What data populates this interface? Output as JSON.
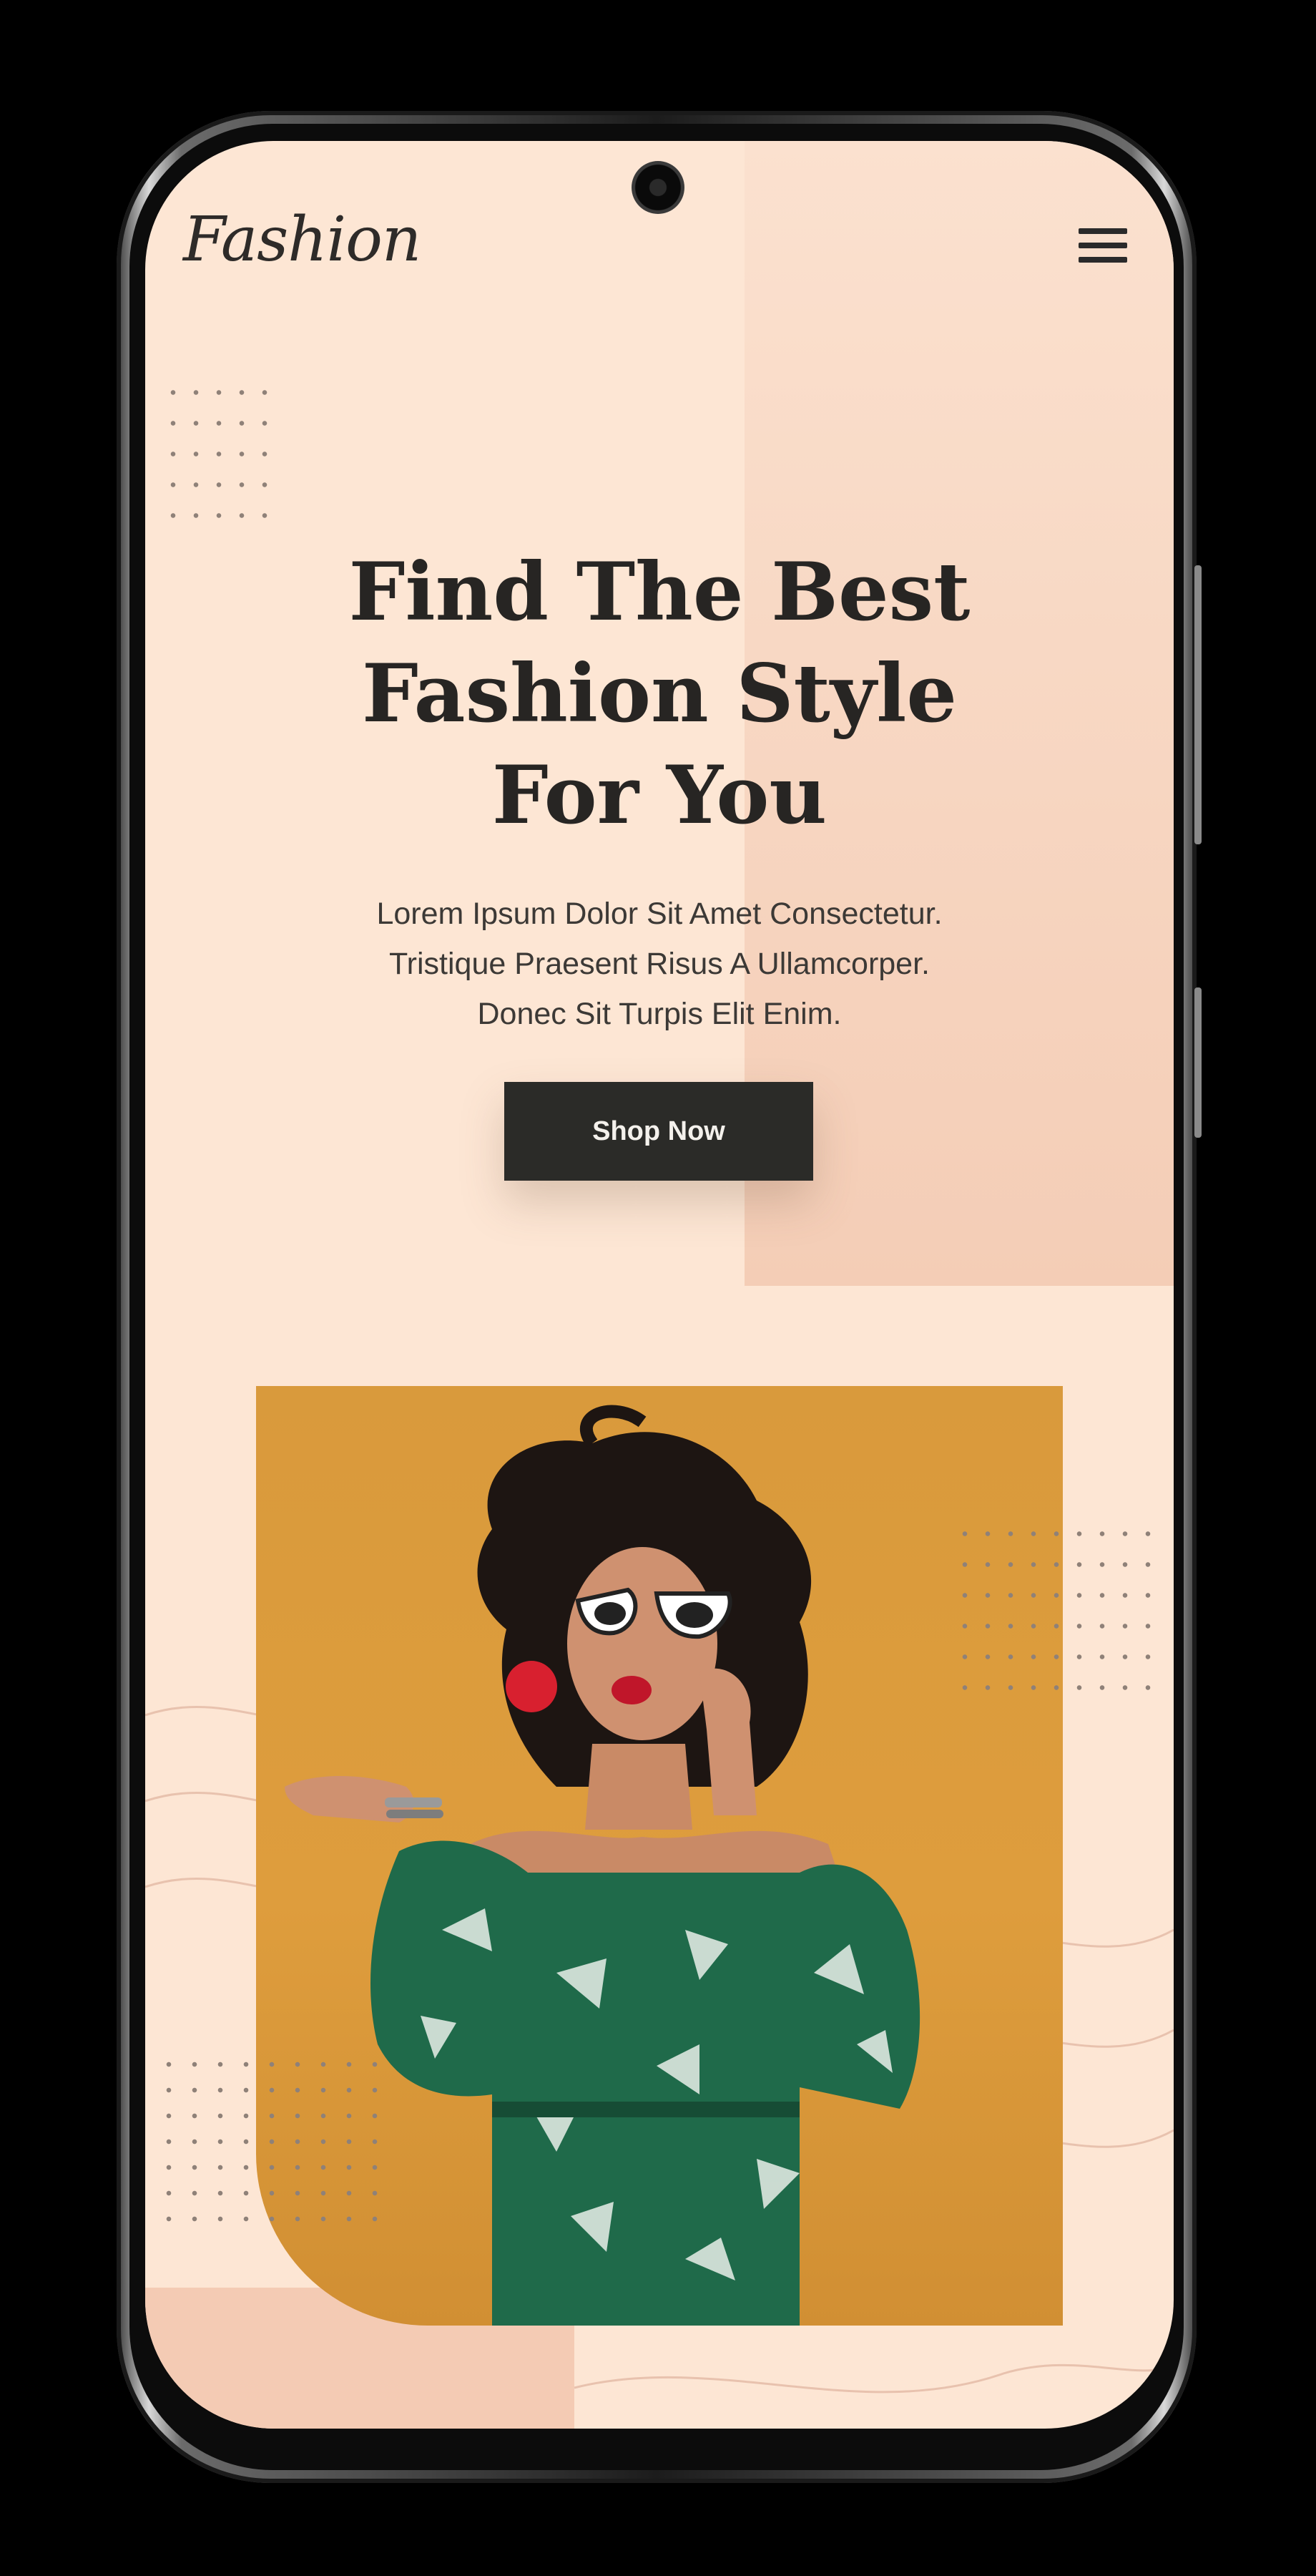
{
  "header": {
    "logo": "Fashion",
    "menu_icon": "hamburger-menu-icon"
  },
  "hero": {
    "title_lines": [
      "Find The Best",
      "Fashion Style",
      "For You"
    ],
    "subtitle_lines": [
      "Lorem Ipsum Dolor Sit Amet Consectetur.",
      "Tristique Praesent Risus A Ullamcorper.",
      "Donec Sit Turpis Elit Enim."
    ],
    "cta_label": "Shop Now"
  },
  "colors": {
    "background": "#fde6d4",
    "accent_panel": "#f4cdb6",
    "button": "#2b2b28",
    "photo_backdrop": "#de9d3d"
  }
}
